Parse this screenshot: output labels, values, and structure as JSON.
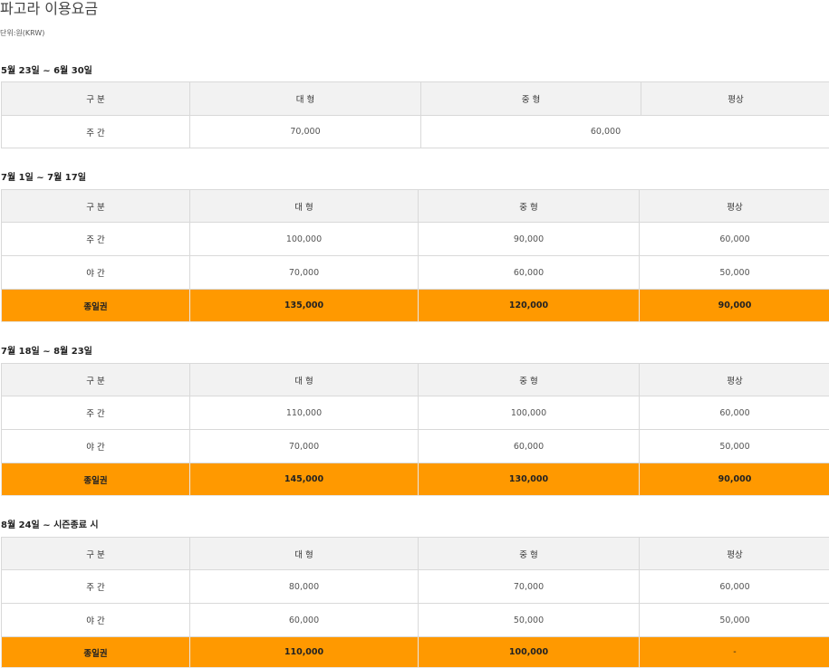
{
  "page": {
    "title": "파고라 이용요금",
    "unit": "단위:원(KRW)"
  },
  "accent_color": "#ff9900",
  "sections": [
    {
      "title": "5월 23일 ~ 6월 30일",
      "headers": [
        "구 분",
        "대 형",
        "중 형",
        "평상"
      ],
      "rows": [
        {
          "label": "주 간",
          "large": "70,000",
          "medium_flat": "60,000"
        }
      ]
    },
    {
      "title": "7월 1일 ~ 7월 17일",
      "headers": [
        "구 분",
        "대 형",
        "중 형",
        "평상"
      ],
      "rows": [
        {
          "label": "주 간",
          "large": "100,000",
          "medium": "90,000",
          "flat": "60,000"
        },
        {
          "label": "야 간",
          "large": "70,000",
          "medium": "60,000",
          "flat": "50,000"
        },
        {
          "label": "종일권",
          "large": "135,000",
          "medium": "120,000",
          "flat": "90,000"
        }
      ]
    },
    {
      "title": "7월 18일 ~ 8월 23일",
      "headers": [
        "구 분",
        "대 형",
        "중 형",
        "평상"
      ],
      "rows": [
        {
          "label": "주 간",
          "large": "110,000",
          "medium": "100,000",
          "flat": "60,000"
        },
        {
          "label": "야 간",
          "large": "70,000",
          "medium": "60,000",
          "flat": "50,000"
        },
        {
          "label": "종일권",
          "large": "145,000",
          "medium": "130,000",
          "flat": "90,000"
        }
      ]
    },
    {
      "title": "8월 24일 ~ 시즌종료 시",
      "headers": [
        "구 분",
        "대 형",
        "중 형",
        "평상"
      ],
      "rows": [
        {
          "label": "주 간",
          "large": "80,000",
          "medium": "70,000",
          "flat": "60,000"
        },
        {
          "label": "야 간",
          "large": "60,000",
          "medium": "50,000",
          "flat": "50,000"
        },
        {
          "label": "종일권",
          "large": "110,000",
          "medium": "100,000",
          "flat": "-"
        }
      ]
    }
  ]
}
